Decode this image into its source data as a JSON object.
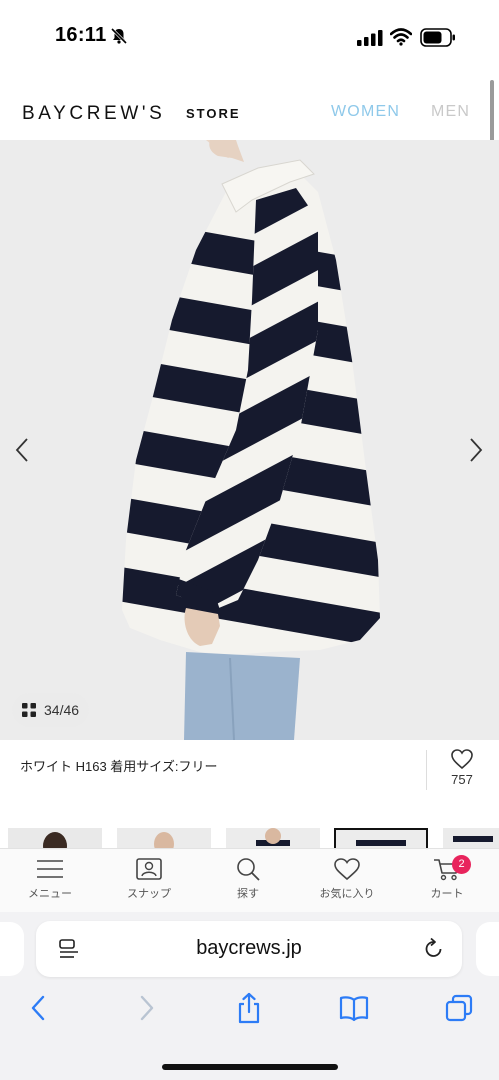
{
  "status_bar": {
    "time": "16:11",
    "icons": [
      "bell-slash-icon",
      "cellular-signal-icon",
      "wifi-icon",
      "battery-icon"
    ]
  },
  "header": {
    "logo": "BAYCREW'S",
    "logo_suffix": "STORE",
    "nav": [
      {
        "label": "WOMEN",
        "color": "#8fc9ea"
      },
      {
        "label": "MEN",
        "color": "#c9c9c9"
      }
    ]
  },
  "gallery": {
    "counter": "34/46",
    "prev_icon": "chevron-left-icon",
    "next_icon": "chevron-right-icon",
    "stripe_colors": [
      "#161a2e",
      "#f4f3ef"
    ],
    "background": "#ececec"
  },
  "caption": {
    "text": "ホワイト H163 着用サイズ:フリー",
    "favorite_count": "757",
    "favorite_icon": "heart-icon"
  },
  "bottom_nav": [
    {
      "label": "メニュー",
      "icon": "hamburger-menu-icon"
    },
    {
      "label": "スナップ",
      "icon": "snap-photo-icon"
    },
    {
      "label": "探す",
      "icon": "search-icon"
    },
    {
      "label": "お気に入り",
      "icon": "heart-icon"
    },
    {
      "label": "カート",
      "icon": "cart-icon",
      "badge": "2"
    }
  ],
  "browser": {
    "url": "baycrews.jp",
    "toolbar_icons": [
      "back-icon",
      "forward-icon",
      "share-icon",
      "bookmarks-icon",
      "tabs-icon"
    ]
  },
  "colors": {
    "accent_women": "#8fc9ea",
    "cart_badge": "#e8245c",
    "safari_blue": "#2d7cf6"
  }
}
